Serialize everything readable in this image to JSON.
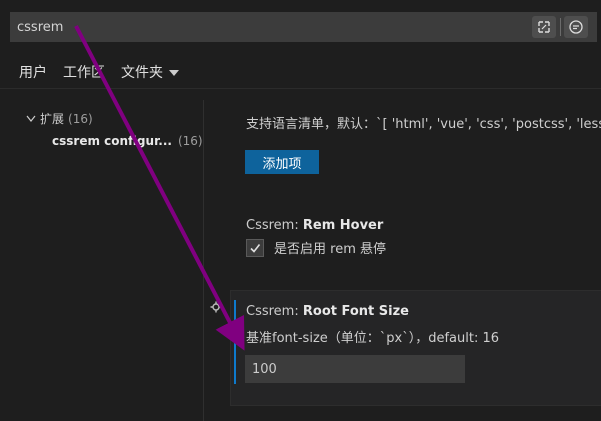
{
  "search": {
    "value": "cssrem"
  },
  "tabs": [
    {
      "label": "用户"
    },
    {
      "label": "工作区"
    },
    {
      "label": "文件夹"
    }
  ],
  "tree": {
    "root": {
      "label": "扩展",
      "count": "(16)"
    },
    "child": {
      "label": "cssrem configur...",
      "count": "(16)"
    }
  },
  "settings": {
    "languages_desc": "支持语言清单，默认：`[ 'html', 'vue', 'css', 'postcss', 'less",
    "add_button": "添加项",
    "rem_hover": {
      "category": "Cssrem:",
      "name": "Rem Hover",
      "checkbox_label": "是否启用 rem 悬停",
      "checked": true
    },
    "root_font_size": {
      "category": "Cssrem:",
      "name": "Root Font Size",
      "description": "基准font-size（单位：`px`），default: 16",
      "value": "100"
    }
  },
  "colors": {
    "accent": "#0e639c",
    "focus_bar": "#0e7acc",
    "annotation_arrow": "#800080"
  },
  "icons": [
    "filter-icon",
    "feedback-icon",
    "chevron-down-icon",
    "gear-icon",
    "check-icon"
  ]
}
